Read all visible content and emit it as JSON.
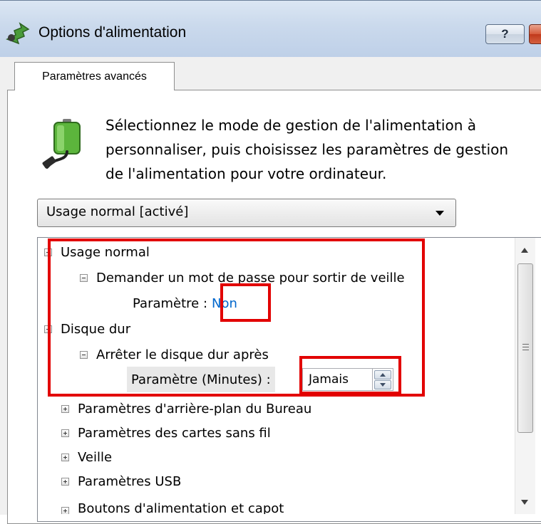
{
  "window": {
    "title": "Options d'alimentation",
    "help_label": "?"
  },
  "tabs": [
    {
      "label": "Paramètres avancés"
    }
  ],
  "description": {
    "line1": "Sélectionnez le mode de gestion de l'alimentation à",
    "line2": "personnaliser, puis choisissez les paramètres de gestion",
    "line3": "de l'alimentation pour votre ordinateur."
  },
  "plan_dropdown": {
    "selected": "Usage normal [activé]"
  },
  "tree": {
    "usage_normal": "Usage normal",
    "password_wake": "Demander un mot de passe pour sortir de veille",
    "setting_label": "Paramètre :",
    "setting_value": "Non",
    "hard_disk": "Disque dur",
    "turn_off_disk": "Arrêter le disque dur après",
    "minutes_label": "Paramètre (Minutes) :",
    "minutes_value": "Jamais",
    "desktop_background": "Paramètres d'arrière-plan du Bureau",
    "wireless": "Paramètres des cartes sans fil",
    "sleep": "Veille",
    "usb": "Paramètres USB",
    "power_buttons": "Boutons d'alimentation et capot"
  },
  "colors": {
    "highlight": "#e20000",
    "link": "#0066cc",
    "titlebar": "#cad9ec"
  },
  "icons": {
    "app": "power-options-icon",
    "plan": "battery-plug-icon"
  }
}
